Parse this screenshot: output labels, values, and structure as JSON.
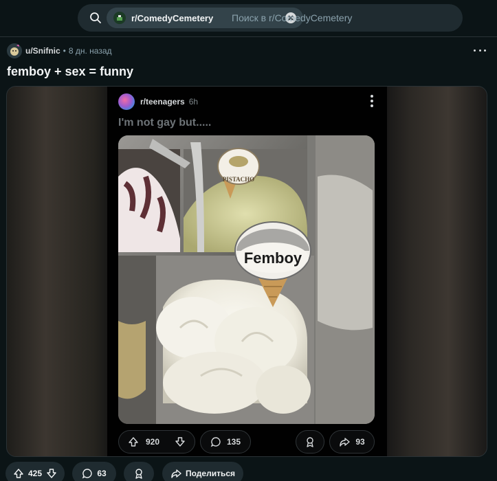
{
  "search": {
    "community_chip": "r/ComedyCemetery",
    "placeholder": "Поиск в r/ComedyCemetery"
  },
  "post": {
    "author": "u/Snifnic",
    "separator": "•",
    "time_ago": "8 дн. назад",
    "title": "femboy + sex = funny"
  },
  "embedded_post": {
    "subreddit": "r/teenagers",
    "time": "6h",
    "title": "I'm not gay but.....",
    "image_labels": {
      "sign_small": "PISTACHO",
      "sign_big": "Femboy"
    },
    "upvotes": "920",
    "comments": "135",
    "shares": "93"
  },
  "actions": {
    "upvotes": "425",
    "comments": "63",
    "share_label": "Поделиться"
  },
  "colors": {
    "background": "#0b1416",
    "search_bg": "#1f2b30",
    "chip_bg": "#33434a",
    "button_bg": "#1f2b30"
  }
}
